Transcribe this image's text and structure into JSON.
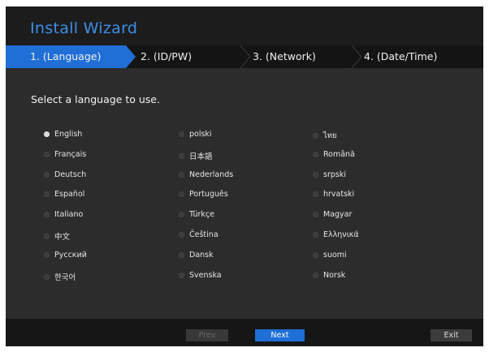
{
  "window": {
    "title": "Install Wizard"
  },
  "steps": [
    {
      "label": "1.  (Language)",
      "active": true
    },
    {
      "label": "2.  (ID/PW)",
      "active": false
    },
    {
      "label": "3.  (Network)",
      "active": false
    },
    {
      "label": "4.  (Date/Time)",
      "active": false
    }
  ],
  "prompt": "Select a language to use.",
  "languages": [
    {
      "label": "English",
      "selected": true
    },
    {
      "label": "Français",
      "selected": false
    },
    {
      "label": "Deutsch",
      "selected": false
    },
    {
      "label": "Español",
      "selected": false
    },
    {
      "label": "Italiano",
      "selected": false
    },
    {
      "label": "中文",
      "selected": false
    },
    {
      "label": "Русский",
      "selected": false
    },
    {
      "label": "한국어",
      "selected": false
    },
    {
      "label": "polski",
      "selected": false
    },
    {
      "label": "日本語",
      "selected": false
    },
    {
      "label": "Nederlands",
      "selected": false
    },
    {
      "label": "Português",
      "selected": false
    },
    {
      "label": "Türkçe",
      "selected": false
    },
    {
      "label": "Čeština",
      "selected": false
    },
    {
      "label": "Dansk",
      "selected": false
    },
    {
      "label": "Svenska",
      "selected": false
    },
    {
      "label": "ไทย",
      "selected": false
    },
    {
      "label": "Română",
      "selected": false
    },
    {
      "label": "srpski",
      "selected": false
    },
    {
      "label": "hrvatski",
      "selected": false
    },
    {
      "label": "Magyar",
      "selected": false
    },
    {
      "label": "Ελληνικά",
      "selected": false
    },
    {
      "label": "suomi",
      "selected": false
    },
    {
      "label": "Norsk",
      "selected": false
    }
  ],
  "buttons": {
    "prev": "Prev",
    "next": "Next",
    "exit": "Exit"
  },
  "colors": {
    "accent": "#1f6fd6",
    "title": "#3d8fe8",
    "panel": "#2c2c2c"
  }
}
